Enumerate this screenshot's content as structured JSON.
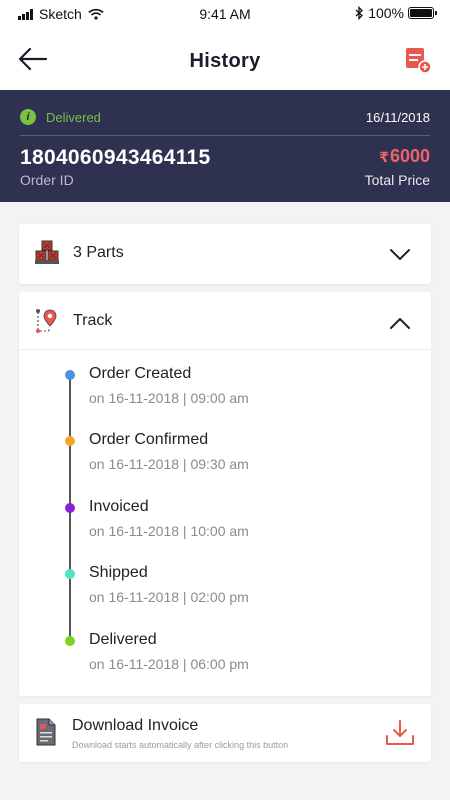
{
  "status_bar": {
    "carrier": "Sketch",
    "time": "9:41 AM",
    "battery": "100%"
  },
  "header": {
    "title": "History"
  },
  "order": {
    "status": "Delivered",
    "date": "16/11/2018",
    "id": "1804060943464115",
    "id_label": "Order ID",
    "currency": "₹",
    "price": "6000",
    "price_label": "Total Price"
  },
  "parts": {
    "label": "3 Parts"
  },
  "track": {
    "label": "Track",
    "events": [
      {
        "title": "Order Created",
        "time": "on 16-11-2018 | 09:00 am",
        "color": "#4a90e2"
      },
      {
        "title": "Order Confirmed",
        "time": "on 16-11-2018 | 09:30 am",
        "color": "#f5a623"
      },
      {
        "title": "Invoiced",
        "time": "on 16-11-2018 | 10:00 am",
        "color": "#8b21d6"
      },
      {
        "title": "Shipped",
        "time": "on 16-11-2018 | 02:00 pm",
        "color": "#50e3c2"
      },
      {
        "title": "Delivered",
        "time": "on 16-11-2018 | 06:00 pm",
        "color": "#7ed321"
      }
    ]
  },
  "download": {
    "title": "Download Invoice",
    "subtitle": "Download starts automatically after clicking this button"
  },
  "colors": {
    "accent": "#e8584f",
    "summary_bg": "#2f3150",
    "delivered_green": "#7bc043"
  }
}
